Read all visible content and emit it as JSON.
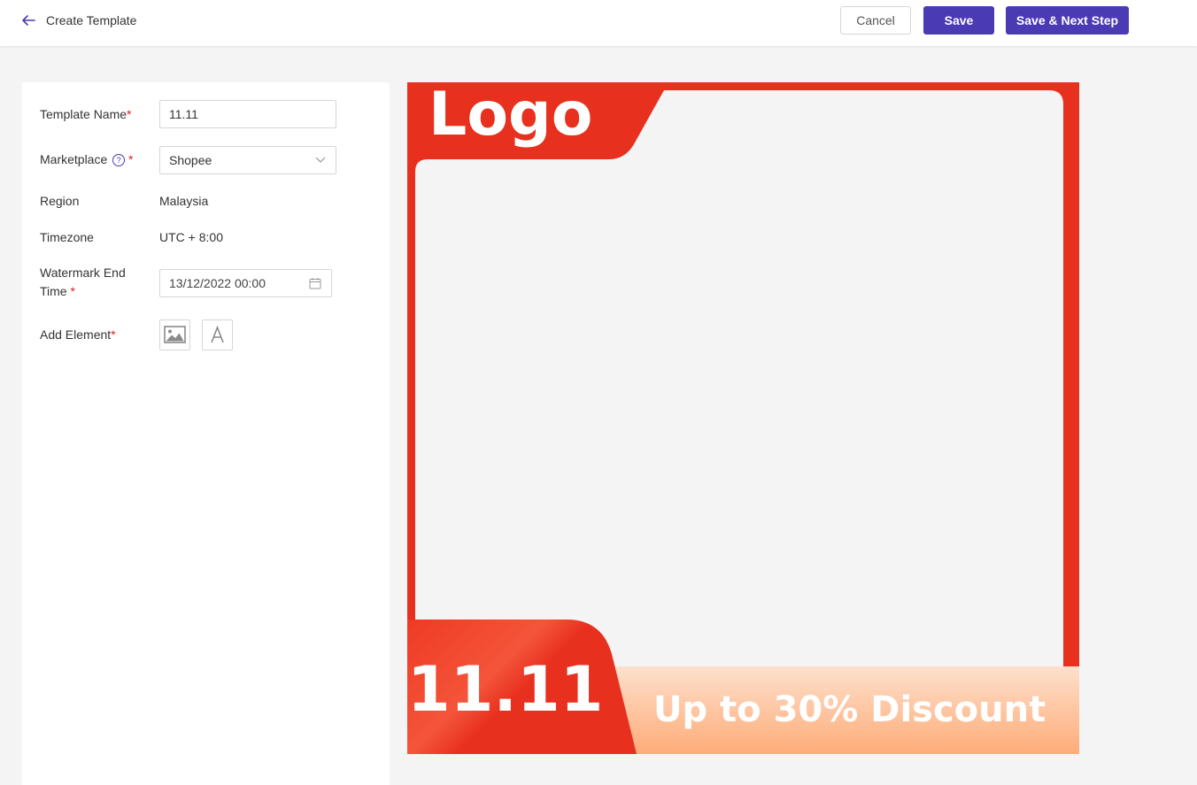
{
  "header": {
    "title": "Create Template",
    "cancel_label": "Cancel",
    "save_label": "Save",
    "save_next_label": "Save & Next Step"
  },
  "form": {
    "template_name_label": "Template Name",
    "template_name_value": "11.11",
    "marketplace_label": "Marketplace",
    "marketplace_value": "Shopee",
    "region_label": "Region",
    "region_value": "Malaysia",
    "timezone_label": "Timezone",
    "timezone_value": "UTC + 8:00",
    "watermark_label_line1": "Watermark End",
    "watermark_label_line2": "Time",
    "watermark_value": "13/12/2022 00:00",
    "add_element_label": "Add Element",
    "required_mark": "*",
    "help_mark": "?"
  },
  "preview": {
    "logo_text": "Logo",
    "date_text": "11.11",
    "discount_text": "Up to 30% Discount"
  },
  "colors": {
    "accent": "#4a3ab4",
    "frame_red": "#e8301e",
    "banner_peach": "#ffb07c"
  },
  "icons": [
    "back-arrow-icon",
    "help-icon",
    "chevron-down-icon",
    "calendar-icon",
    "image-icon",
    "text-icon"
  ]
}
